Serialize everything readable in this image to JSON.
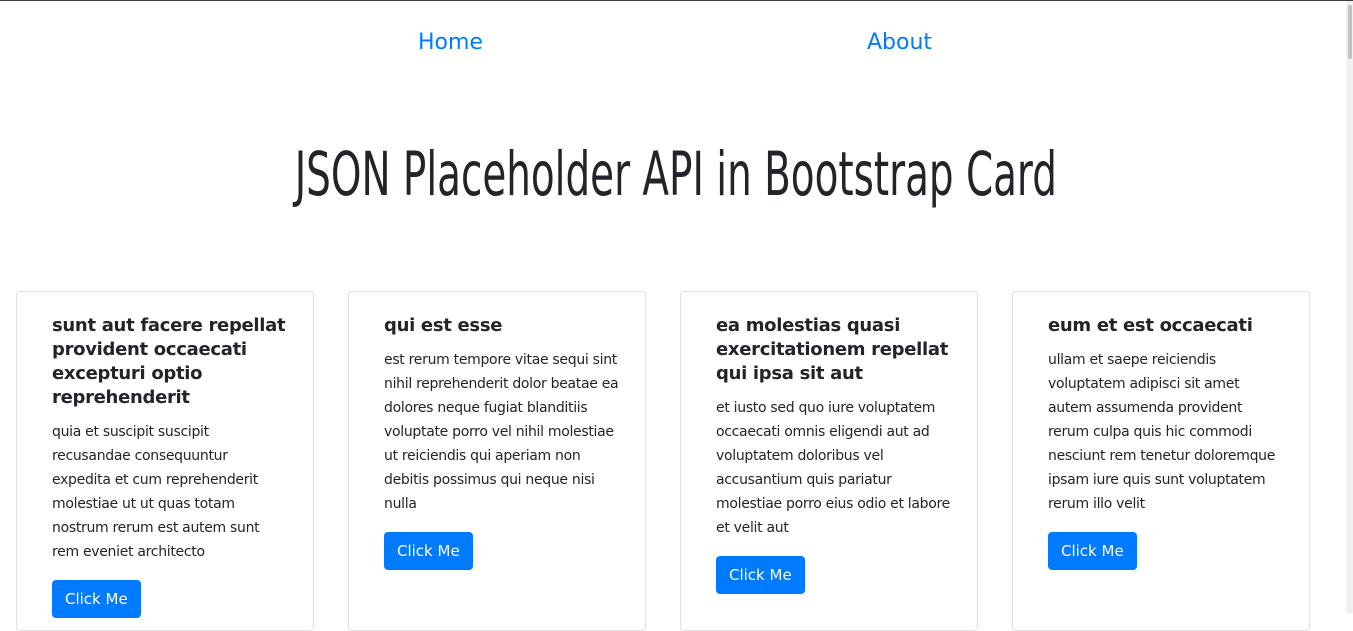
{
  "nav": {
    "home": "Home",
    "about": "About"
  },
  "page_title": "JSON Placeholder API in Bootstrap Card",
  "colors": {
    "link": "#007bff",
    "button": "#007bff",
    "text": "#212529"
  },
  "cards": [
    {
      "title": "sunt aut facere repellat provident occaecati excepturi optio reprehenderit",
      "body": "quia et suscipit suscipit recusandae consequuntur expedita et cum reprehenderit molestiae ut ut quas totam nostrum rerum est autem sunt rem eveniet architecto",
      "button": "Click Me"
    },
    {
      "title": "qui est esse",
      "body": "est rerum tempore vitae sequi sint nihil reprehenderit dolor beatae ea dolores neque fugiat blanditiis voluptate porro vel nihil molestiae ut reiciendis qui aperiam non debitis possimus qui neque nisi nulla",
      "button": "Click Me"
    },
    {
      "title": "ea molestias quasi exercitationem repellat qui ipsa sit aut",
      "body": "et iusto sed quo iure voluptatem occaecati omnis eligendi aut ad voluptatem doloribus vel accusantium quis pariatur molestiae porro eius odio et labore et velit aut",
      "button": "Click Me"
    },
    {
      "title": "eum et est occaecati",
      "body": "ullam et saepe reiciendis voluptatem adipisci sit amet autem assumenda provident rerum culpa quis hic commodi nesciunt rem tenetur doloremque ipsam iure quis sunt voluptatem rerum illo velit",
      "button": "Click Me"
    }
  ]
}
